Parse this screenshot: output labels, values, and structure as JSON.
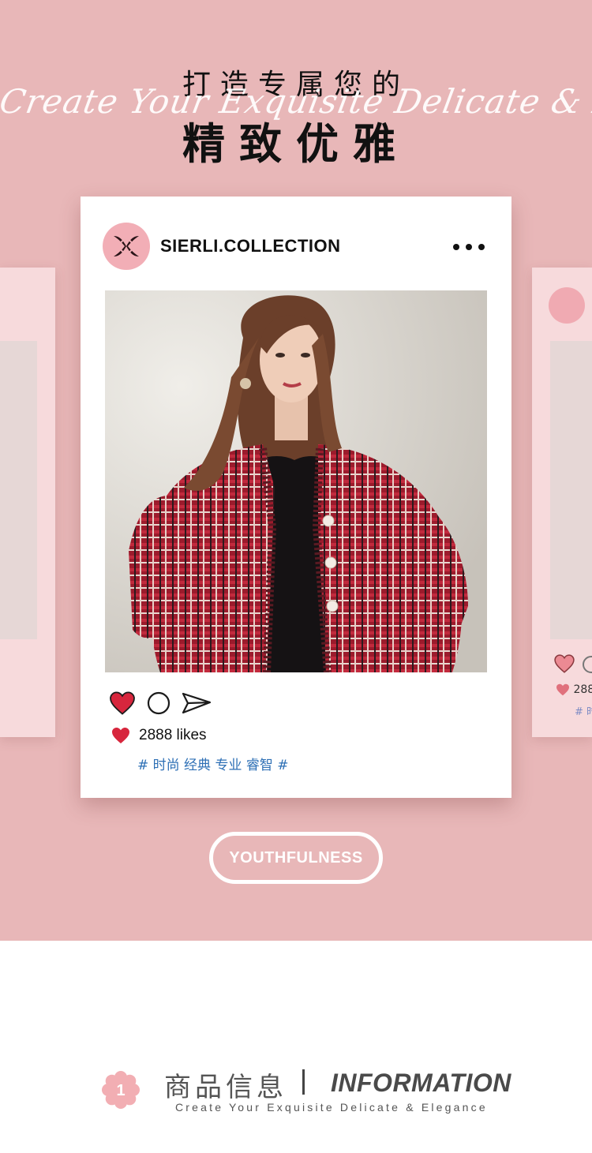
{
  "hero": {
    "title_line1": "打造专属您的",
    "script_text": "Create Your Exquisite Delicate & Elegance",
    "title_line2": "精致优雅",
    "background_color": "#e8b7b8"
  },
  "post": {
    "account_name": "SIERLI.COLLECTION",
    "avatar_icon": "sierli-logo-icon",
    "menu_icon": "more-dots-icon",
    "photo_description_icon": "fashion-photo",
    "actions": [
      {
        "name": "like-heart-icon",
        "color": "#d7263d"
      },
      {
        "name": "comment-icon"
      },
      {
        "name": "share-icon"
      }
    ],
    "likes_text": "2888 likes",
    "tags": "# 时尚 经典 专业 睿智 #",
    "tag_color": "#2d6fb5"
  },
  "side_card_right": {
    "likes_partial": "288",
    "tags_partial": "# 时"
  },
  "cta": {
    "label": "YOUTHFULNESS"
  },
  "info_header": {
    "badge_number": "1",
    "title_cn": "商品信息",
    "title_en": "INFORMATION",
    "subtitle": "Create Your Exquisite Delicate & Elegance"
  }
}
